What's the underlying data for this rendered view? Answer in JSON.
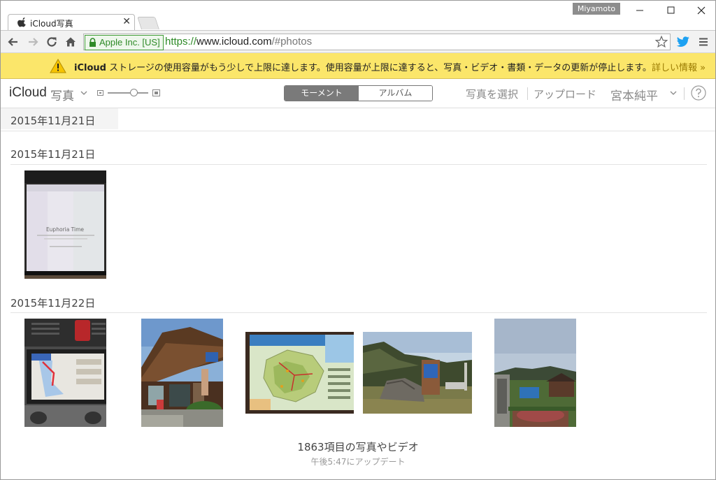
{
  "browser": {
    "tab_title": "iCloud写真",
    "profile_name": "Miyamoto",
    "ev_label": "Apple Inc. [US]",
    "url_scheme": "https://",
    "url_host": "www.icloud.com",
    "url_path": "/#photos",
    "icons": [
      "back-icon",
      "forward-icon",
      "reload-icon",
      "home-icon",
      "lock-icon",
      "star-icon",
      "twitter-icon",
      "menu-icon"
    ]
  },
  "warning": {
    "brand": "iCloud",
    "message": " ストレージの使用容量がもう少しで上限に達します。使用容量が上限に達すると、写真・ビデオ・書類・データの更新が停止します。",
    "link": "詳しい情報 »"
  },
  "app": {
    "brand": "iCloud",
    "app_name": "写真",
    "segments": {
      "moments": "モーメント",
      "albums": "アルバム"
    },
    "select_photos": "写真を選択",
    "upload": "アップロード",
    "user_name": "宮本純平",
    "accent": "#7a7a7a"
  },
  "content": {
    "sticky_date": "2015年11月21日",
    "sections": [
      {
        "date": "2015年11月21日",
        "photos": [
          "photo-tablet-screen"
        ]
      },
      {
        "date": "2015年11月22日",
        "photos": [
          "photo-car-navigation",
          "photo-wooden-station",
          "photo-trail-map",
          "photo-stone-monument",
          "photo-mountain-village"
        ]
      }
    ],
    "tablet_screen_text": "Euphoria Time",
    "item_count": "1863項目の写真やビデオ",
    "updated": "午後5:47にアップデート"
  },
  "colors": {
    "warning_bg": "#fbe66a",
    "secure_green": "#2f8a28",
    "twitter_blue": "#1da1f2"
  }
}
